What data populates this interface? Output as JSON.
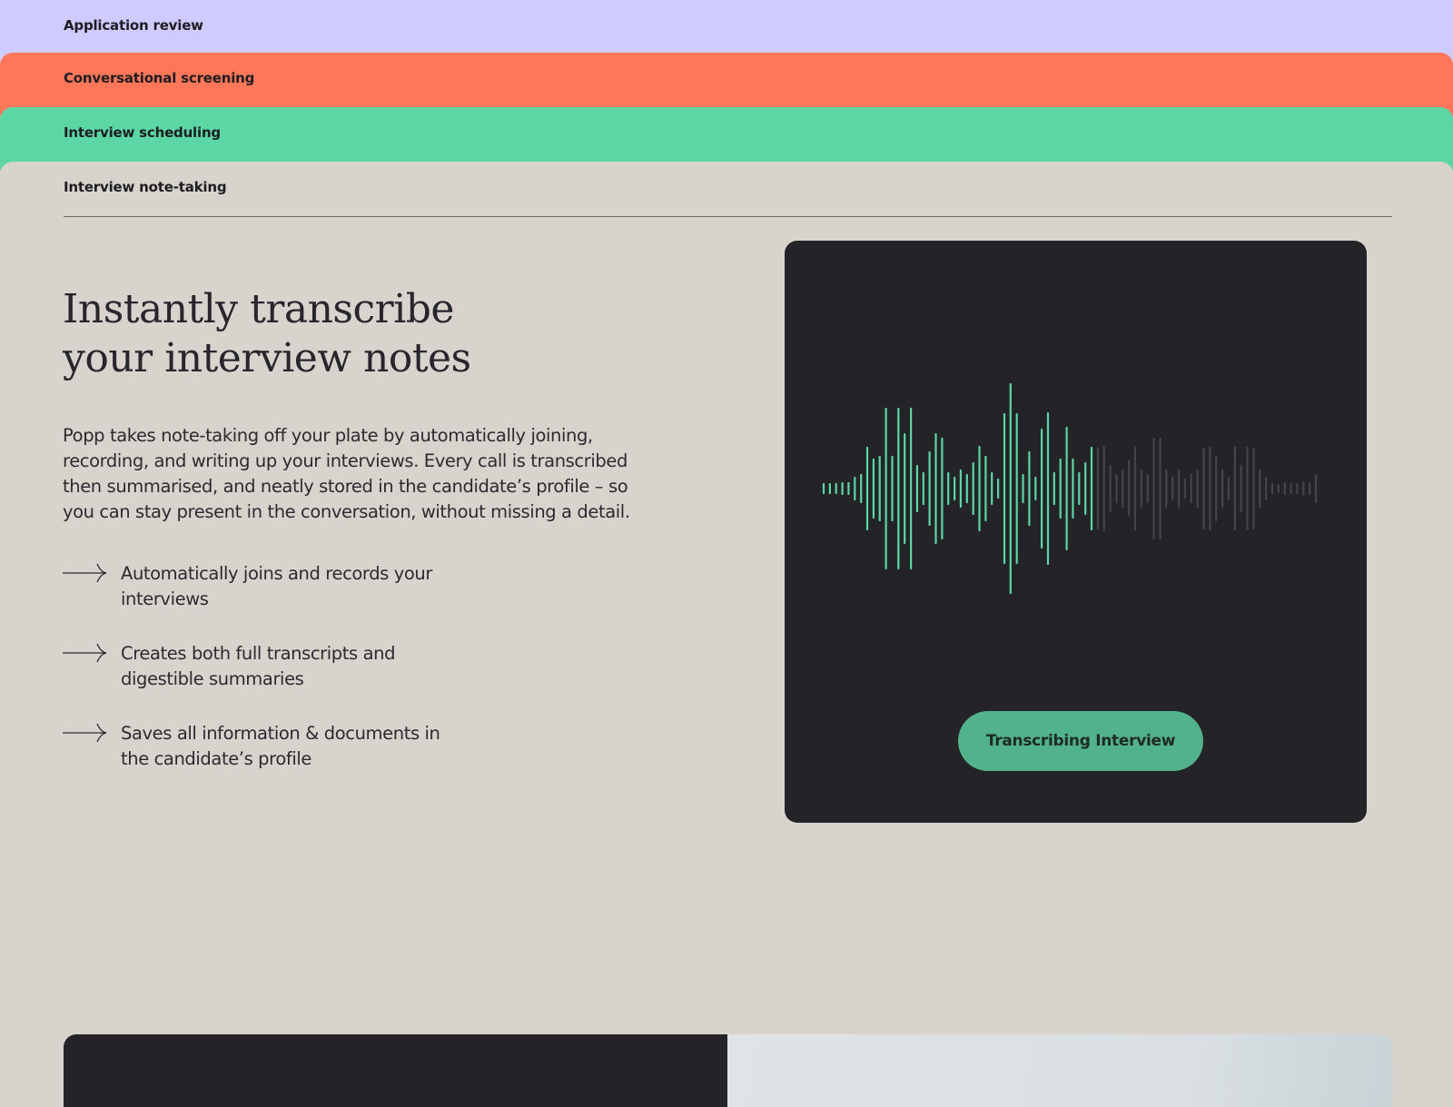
{
  "tabs": [
    {
      "label": "Application review",
      "color": "#cfcbff"
    },
    {
      "label": "Conversational screening",
      "color": "#ff7759"
    },
    {
      "label": "Interview scheduling",
      "color": "#5bd6a4"
    },
    {
      "label": "Interview note-taking",
      "color": "#d8d3cc"
    }
  ],
  "active_tab": "Interview note-taking",
  "section": {
    "headline": "Instantly transcribe\nyour interview notes",
    "description": "Popp takes note-taking off your plate by automatically joining, recording, and writing up your interviews. Every call is transcribed then summarised, and neatly stored in the candidate’s profile – so you can stay present in the conversation, without missing a detail.",
    "features": [
      {
        "text": "Automatically joins and records your interviews",
        "icon": "arrow-right-icon"
      },
      {
        "text": "Creates both full transcripts and digestible summaries",
        "icon": "arrow-right-icon"
      },
      {
        "text": "Saves all information & documents in the candidate’s profile",
        "icon": "arrow-right-icon"
      }
    ]
  },
  "transcription_card": {
    "status_label": "Transcribing Interview",
    "progress_fraction": 0.55,
    "colors": {
      "background": "#232328",
      "played": "#5bd6a4",
      "unplayed": "#46434f",
      "button": "#52b28c"
    }
  }
}
